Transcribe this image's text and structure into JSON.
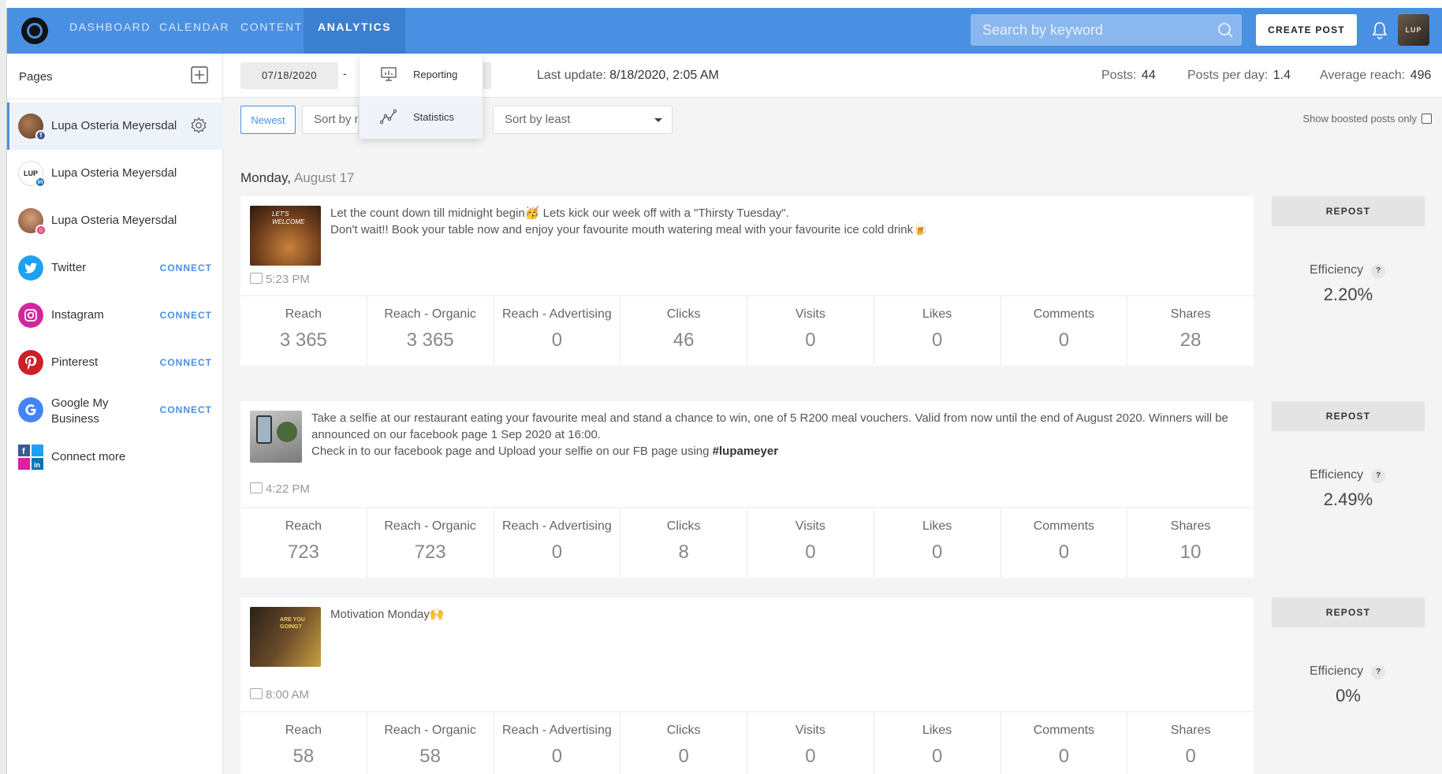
{
  "nav": {
    "items": [
      {
        "label": "DASHBOARD"
      },
      {
        "label": "CALENDAR"
      },
      {
        "label": "CONTENT"
      },
      {
        "label": "ANALYTICS"
      }
    ],
    "search_placeholder": "Search by keyword",
    "create_post": "CREATE POST",
    "avatar_text": "LUP",
    "accent": "#4a90e2"
  },
  "sidebar": {
    "title": "Pages",
    "items": [
      {
        "label": "Lupa Osteria Meyersdal",
        "icon": "facebook-page-avatar"
      },
      {
        "label": "Lupa Osteria Meyersdal",
        "icon": "linkedin-page-avatar"
      },
      {
        "label": "Lupa Osteria Meyersdal",
        "icon": "instagram-page-avatar"
      },
      {
        "label": "Twitter",
        "connect": "CONNECT",
        "icon": "twitter-icon",
        "color": "#1da1f2"
      },
      {
        "label": "Instagram",
        "connect": "CONNECT",
        "icon": "instagram-icon",
        "color": "#d6249f"
      },
      {
        "label": "Pinterest",
        "connect": "CONNECT",
        "icon": "pinterest-icon",
        "color": "#cb2027"
      },
      {
        "label": "Google My Business",
        "connect": "CONNECT",
        "icon": "google-icon",
        "color": "#4285f4"
      },
      {
        "label": "Connect more",
        "icon": "social-grid-icon"
      }
    ]
  },
  "filters": {
    "date_from": "07/18/2020",
    "date_sep": "-",
    "last_update_label": "Last update:",
    "last_update_value": "8/18/2020, 2:05 AM",
    "posts_label": "Posts:",
    "posts_value": "44",
    "ppd_label": "Posts per day:",
    "ppd_value": "1.4",
    "reach_label": "Average reach:",
    "reach_value": "496",
    "newest": "Newest",
    "sort_most": "Sort by most",
    "sort_least": "Sort by least",
    "boosted_label": "Show boosted posts only"
  },
  "dropdown": {
    "items": [
      {
        "label": "Reporting"
      },
      {
        "label": "Statistics"
      }
    ]
  },
  "day": {
    "weekday": "Monday,",
    "date": "August 17"
  },
  "metric_labels": [
    "Reach",
    "Reach - Organic",
    "Reach - Advertising",
    "Clicks",
    "Visits",
    "Likes",
    "Comments",
    "Shares"
  ],
  "posts": [
    {
      "text1": "Let the count down till midnight begin🥳  Lets kick our week off with a \"Thirsty Tuesday\".",
      "text2": "Don't wait!! Book your table now and enjoy your favourite mouth watering meal with your favourite ice cold drink🍺",
      "time": "5:23 PM",
      "values": [
        "3 365",
        "3 365",
        "0",
        "46",
        "0",
        "0",
        "0",
        "28"
      ],
      "repost": "REPOST",
      "eff_label": "Efficiency",
      "eff_q": "?",
      "efficiency": "2.20%"
    },
    {
      "text1": "Take a selfie at our restaurant eating your favourite meal and stand a chance to win, one of 5 R200 meal vouchers. Valid from now until the end of August 2020. Winners will be announced on our facebook page 1 Sep 2020 at 16:00.",
      "text2": "Check in to our facebook page and Upload your selfie on our FB page using",
      "tag": "#lupameyer",
      "time": "4:22 PM",
      "values": [
        "723",
        "723",
        "0",
        "8",
        "0",
        "0",
        "0",
        "10"
      ],
      "repost": "REPOST",
      "eff_label": "Efficiency",
      "eff_q": "?",
      "efficiency": "2.49%"
    },
    {
      "text1": "Motivation Monday🙌",
      "time": "8:00 AM",
      "values": [
        "58",
        "58",
        "0",
        "0",
        "0",
        "0",
        "0",
        "0"
      ],
      "repost": "REPOST",
      "eff_label": "Efficiency",
      "eff_q": "?",
      "efficiency": "0%"
    }
  ]
}
